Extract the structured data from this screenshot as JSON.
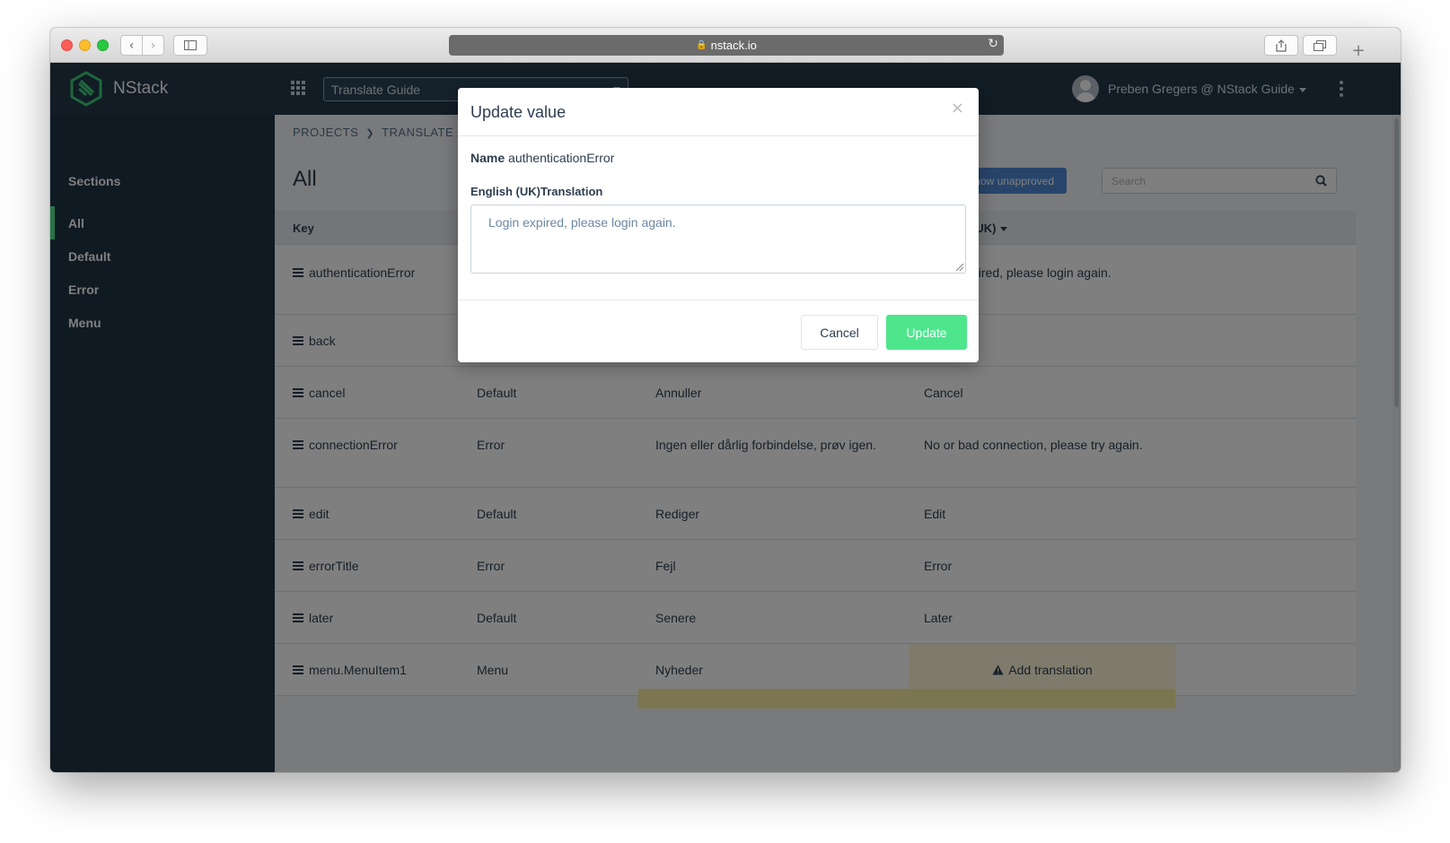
{
  "browser": {
    "url": "nstack.io",
    "colors": {
      "close": "#fc5f57",
      "minimize": "#fdbc2e",
      "zoom": "#28c840"
    }
  },
  "app": {
    "logo_text": "NStack",
    "project_select_value": "Translate Guide",
    "user_label": "Preben Gregers @ NStack Guide"
  },
  "sidebar": {
    "title": "Sections",
    "items": [
      {
        "label": "All",
        "active": true
      },
      {
        "label": "Default",
        "active": false
      },
      {
        "label": "Error",
        "active": false
      },
      {
        "label": "Menu",
        "active": false
      }
    ]
  },
  "main": {
    "breadcrumb": [
      "PROJECTS",
      "TRANSLATE"
    ],
    "title": "All",
    "show_unapproved_label": "how unapproved",
    "search_placeholder": "Search",
    "columns": {
      "key": "Key",
      "english": "(UK)"
    },
    "rows": [
      {
        "key": "authenticationError",
        "section": "",
        "danish": "",
        "english": "pired, please login again."
      },
      {
        "key": "back",
        "section": "",
        "danish": "",
        "english": ""
      },
      {
        "key": "cancel",
        "section": "Default",
        "danish": "Annuller",
        "english": "Cancel"
      },
      {
        "key": "connectionError",
        "section": "Error",
        "danish": "Ingen eller dårlig forbindelse, prøv igen.",
        "english": "No or bad connection, please try again."
      },
      {
        "key": "edit",
        "section": "Default",
        "danish": "Rediger",
        "english": "Edit"
      },
      {
        "key": "errorTitle",
        "section": "Error",
        "danish": "Fejl",
        "english": "Error"
      },
      {
        "key": "later",
        "section": "Default",
        "danish": "Senere",
        "english": "Later"
      },
      {
        "key": "menu.MenuItem1",
        "section": "Menu",
        "danish": "Nyheder",
        "english": ""
      }
    ],
    "add_translation_label": "Add translation"
  },
  "modal": {
    "title": "Update value",
    "close_symbol": "×",
    "name_label": "Name",
    "name_value": "authenticationError",
    "language_label": "English (UK)Translation",
    "translation_value": "Login expired, please login again.",
    "cancel_label": "Cancel",
    "update_label": "Update",
    "accent_color": "#4ee68d"
  }
}
